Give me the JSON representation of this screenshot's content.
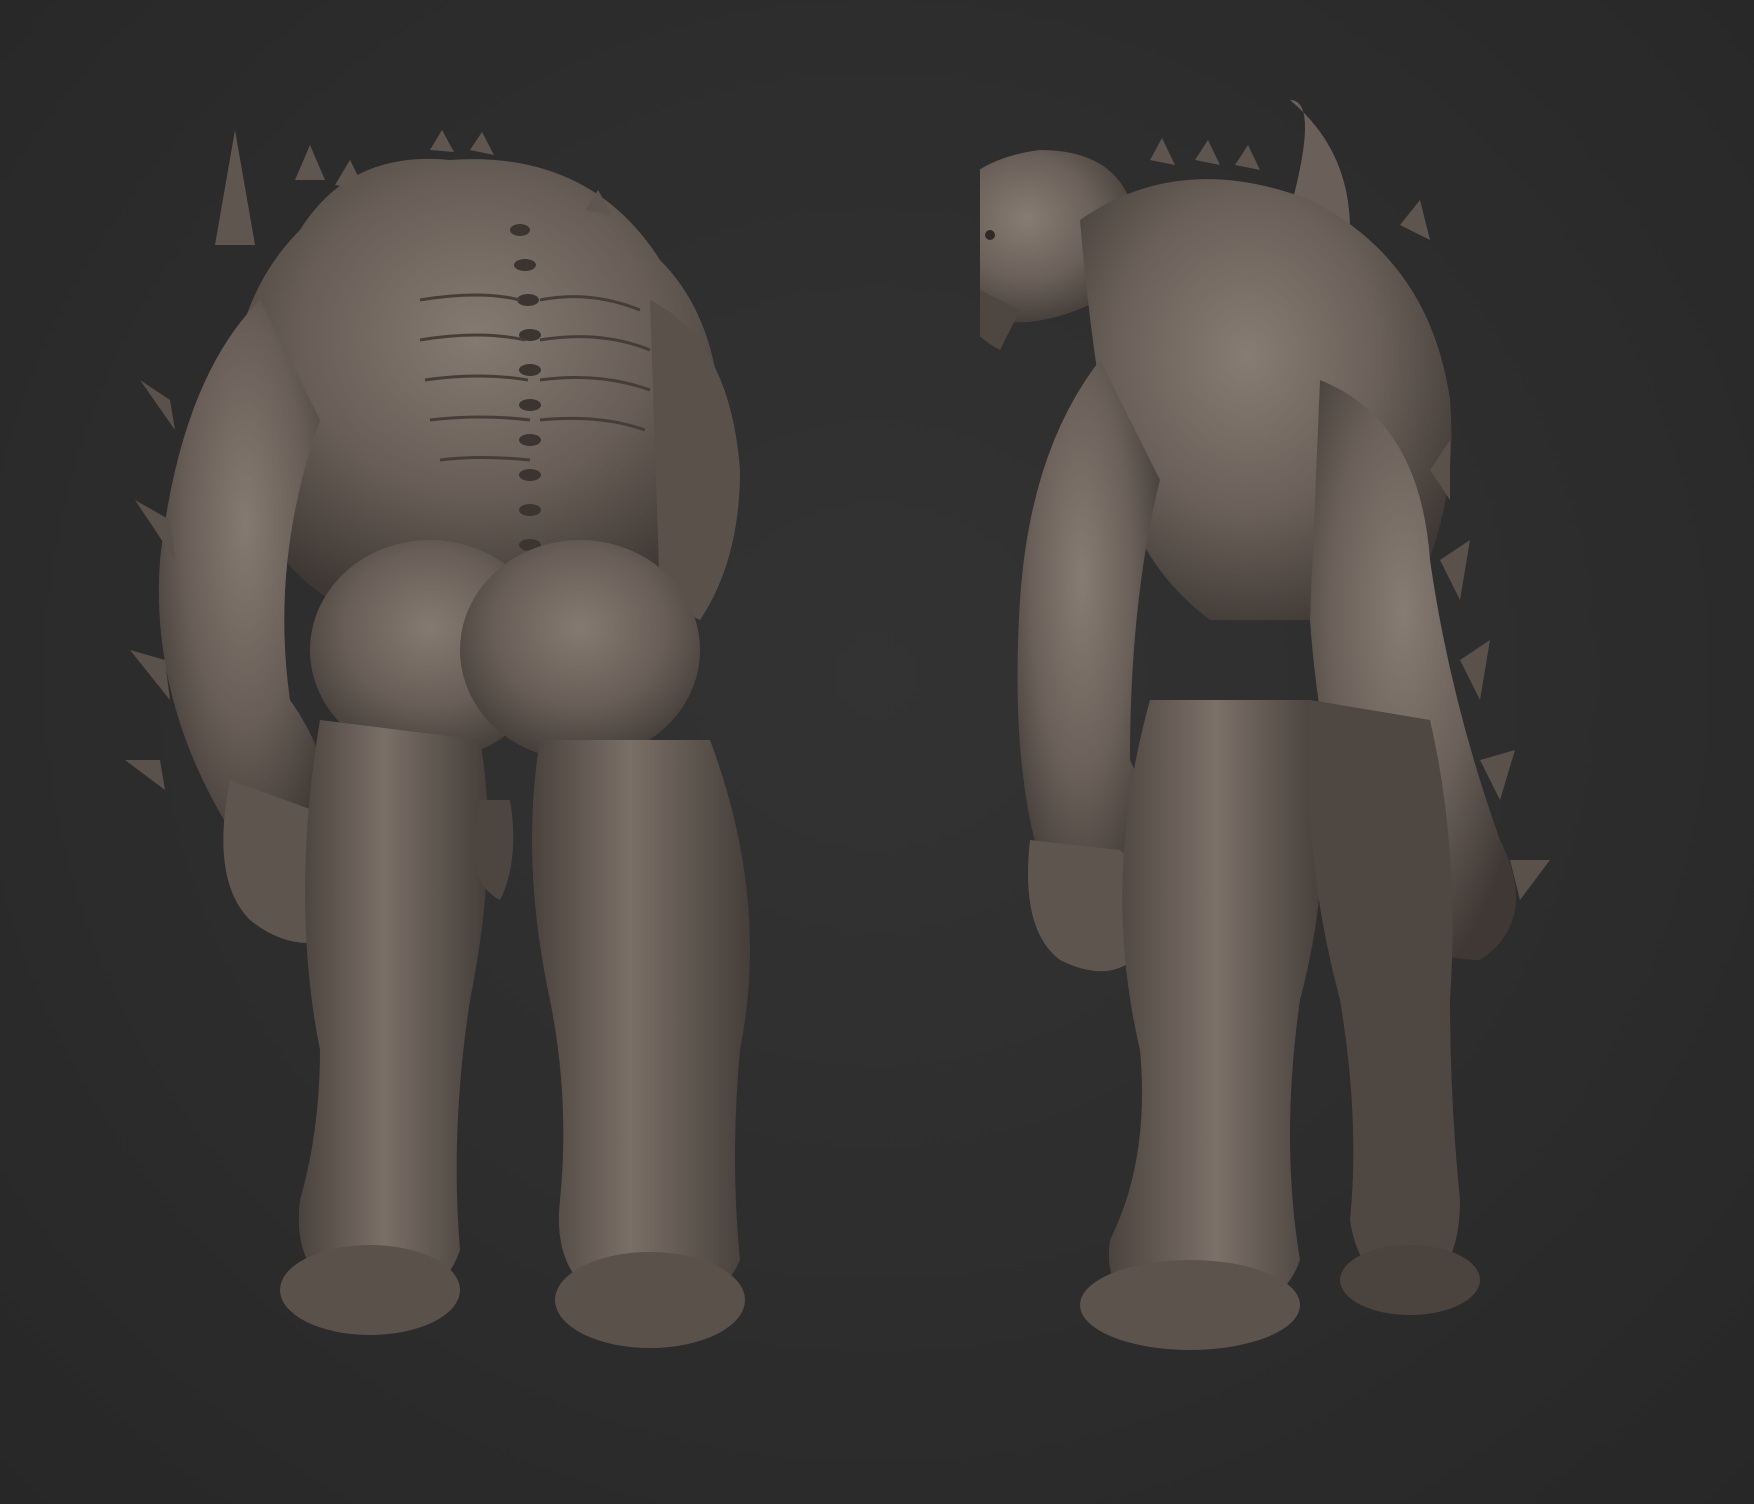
{
  "scene": {
    "background_color": "#2e2e2e",
    "clay_color": "#6e645d",
    "clay_shadow": "#3a3430",
    "clay_highlight": "#8c8178",
    "views": [
      {
        "id": "back",
        "icon": "creature-back-view-icon"
      },
      {
        "id": "side",
        "icon": "creature-side-view-icon"
      }
    ]
  }
}
